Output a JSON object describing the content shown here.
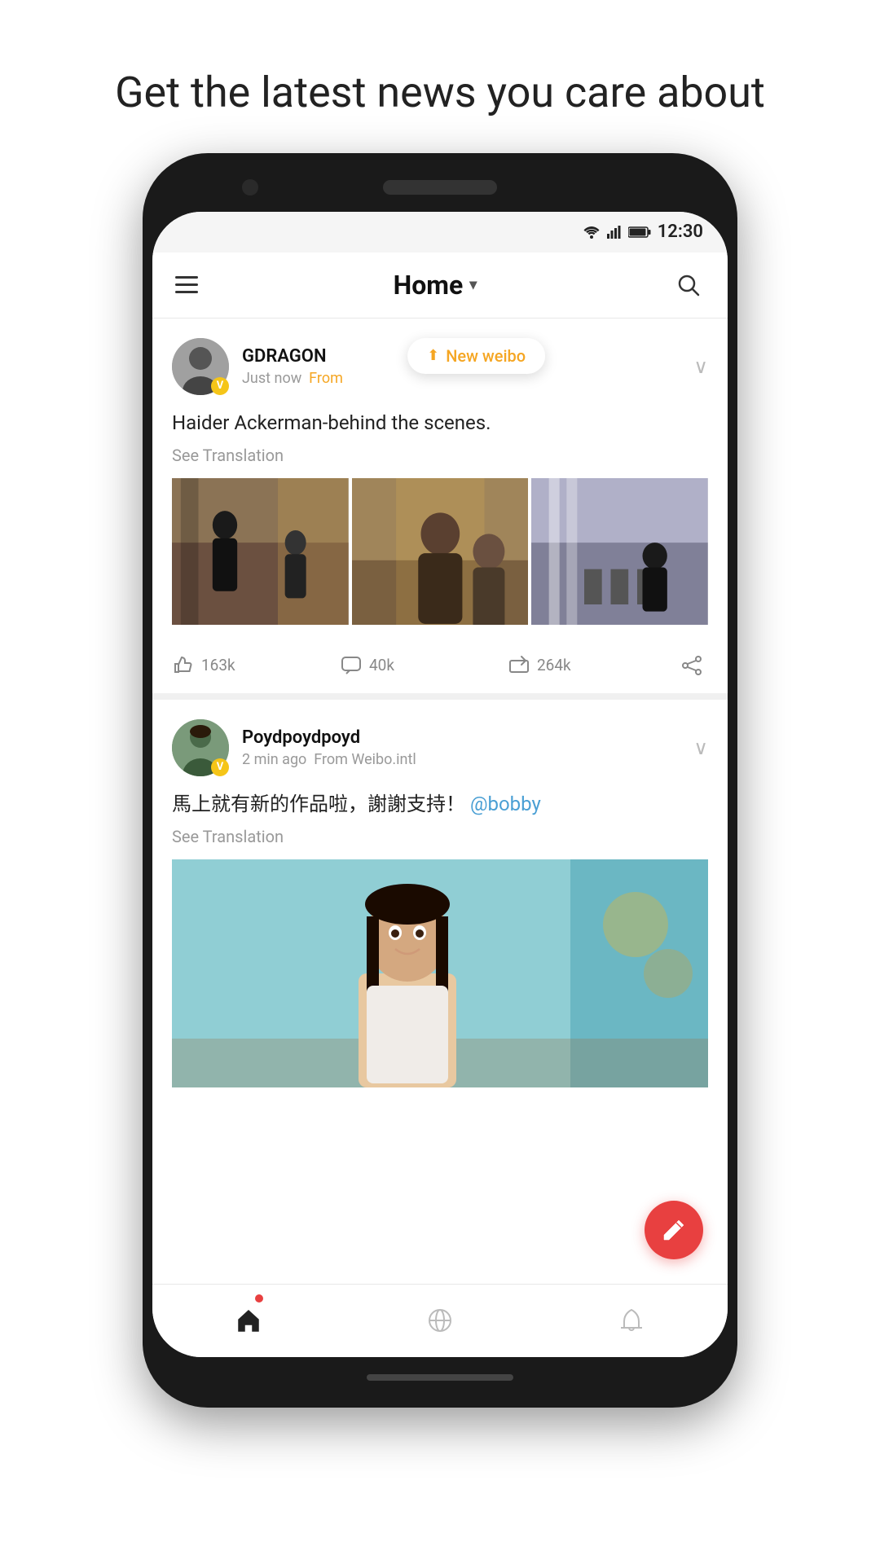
{
  "page": {
    "headline": "Get the latest news you care about"
  },
  "status_bar": {
    "time": "12:30"
  },
  "header": {
    "title": "Home",
    "menu_label": "Menu",
    "search_label": "Search"
  },
  "new_weibo_toast": {
    "label": "New weibo"
  },
  "posts": [
    {
      "id": "post1",
      "username": "GDRAGON",
      "time": "Just now",
      "from": "From",
      "text": "Haider Ackerman-behind the scenes.",
      "see_translation": "See Translation",
      "images": [
        "scene1",
        "scene2",
        "scene3"
      ],
      "likes": "163k",
      "comments": "40k",
      "reposts": "264k"
    },
    {
      "id": "post2",
      "username": "Poydpoydpoyd",
      "time": "2 min ago",
      "from": "From Weibo.intl",
      "text": "馬上就有新的作品啦，謝謝支持！",
      "mention": "@bobby",
      "see_translation": "See Translation",
      "images": [
        "portrait"
      ],
      "likes": "",
      "comments": "",
      "reposts": ""
    }
  ],
  "fab": {
    "label": "Compose"
  },
  "bottom_nav": {
    "items": [
      {
        "label": "Home",
        "icon": "home-icon",
        "active": true
      },
      {
        "label": "Discover",
        "icon": "discover-icon",
        "active": false
      },
      {
        "label": "Notifications",
        "icon": "bell-icon",
        "active": false
      }
    ]
  }
}
